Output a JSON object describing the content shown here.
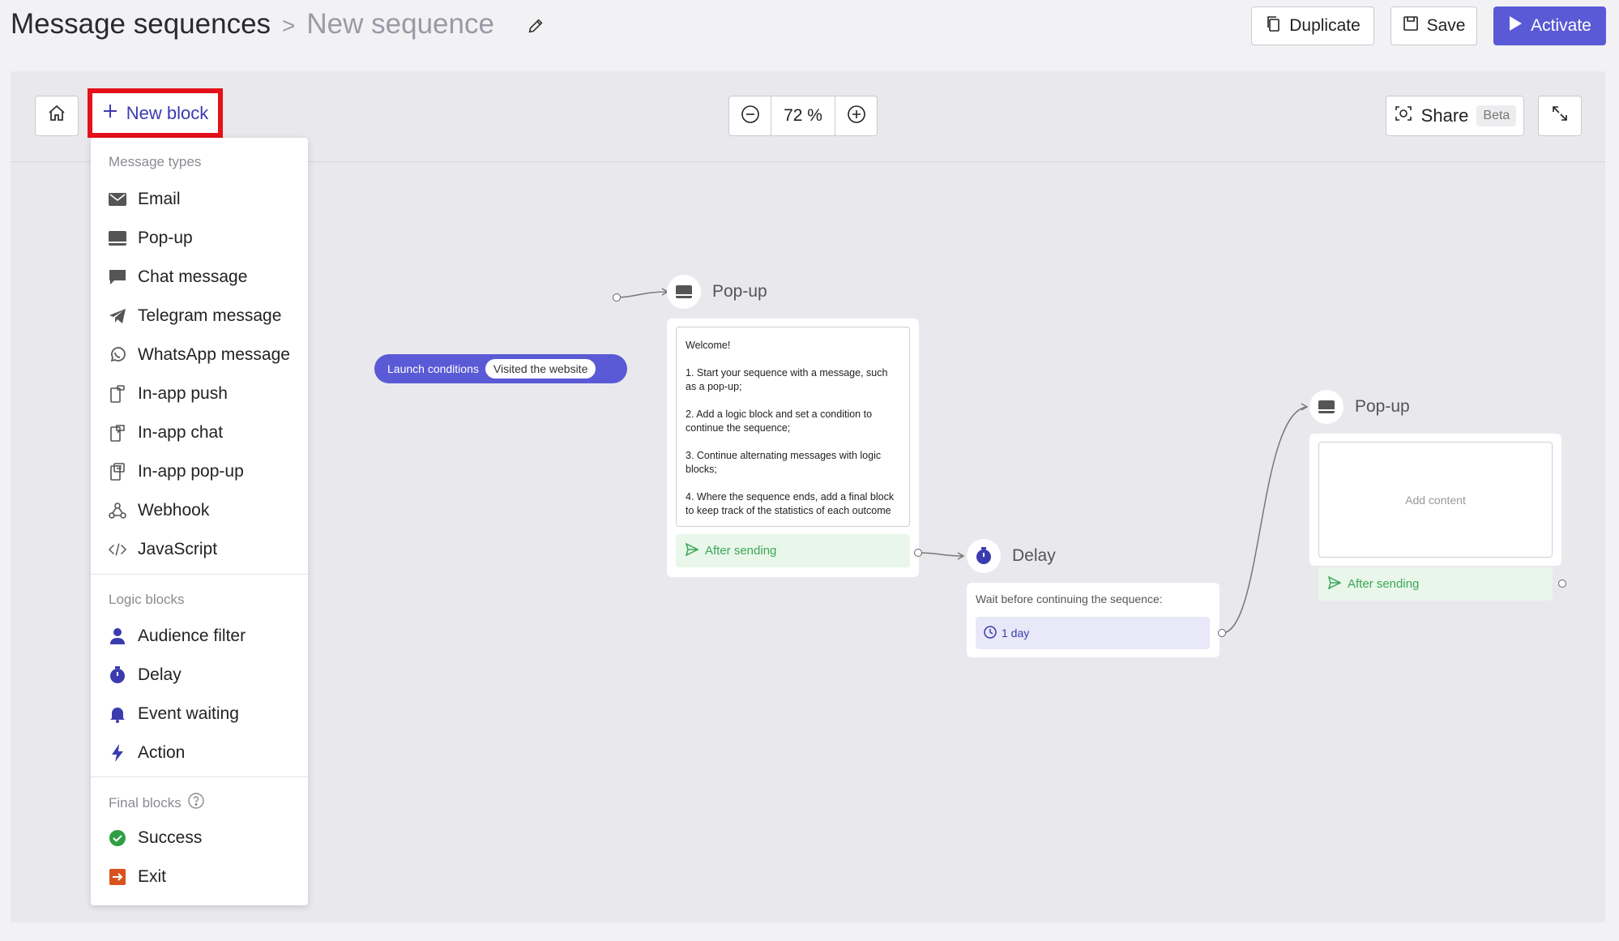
{
  "header": {
    "breadcrumb_root": "Message sequences",
    "breadcrumb_current": "New sequence",
    "duplicate_label": "Duplicate",
    "save_label": "Save",
    "activate_label": "Activate"
  },
  "canvas_toolbar": {
    "new_block_label": "New block",
    "zoom_value": "72 %",
    "share_label": "Share",
    "share_badge": "Beta"
  },
  "menu": {
    "message_types_heading": "Message types",
    "message_types": [
      {
        "label": "Email",
        "icon": "email-icon"
      },
      {
        "label": "Pop-up",
        "icon": "popup-icon"
      },
      {
        "label": "Chat message",
        "icon": "chat-icon"
      },
      {
        "label": "Telegram message",
        "icon": "telegram-icon"
      },
      {
        "label": "WhatsApp message",
        "icon": "whatsapp-icon"
      },
      {
        "label": "In-app push",
        "icon": "in-app-push-icon"
      },
      {
        "label": "In-app chat",
        "icon": "in-app-chat-icon"
      },
      {
        "label": "In-app pop-up",
        "icon": "in-app-popup-icon"
      },
      {
        "label": "Webhook",
        "icon": "webhook-icon"
      },
      {
        "label": "JavaScript",
        "icon": "code-icon"
      }
    ],
    "logic_blocks_heading": "Logic blocks",
    "logic_blocks": [
      {
        "label": "Audience filter",
        "icon": "person-icon"
      },
      {
        "label": "Delay",
        "icon": "timer-icon"
      },
      {
        "label": "Event waiting",
        "icon": "bell-icon"
      },
      {
        "label": "Action",
        "icon": "lightning-icon"
      }
    ],
    "final_blocks_heading": "Final blocks",
    "final_blocks": [
      {
        "label": "Success",
        "icon": "check-circle-icon"
      },
      {
        "label": "Exit",
        "icon": "exit-icon"
      }
    ]
  },
  "flow": {
    "launch_label": "Launch conditions",
    "launch_value": "Visited the website",
    "popup1": {
      "title": "Pop-up",
      "content": [
        "Welcome!",
        "1. Start your sequence with a message, such as a pop-up;",
        "2. Add a logic block and set a condition to continue the sequence;",
        "3. Continue alternating messages with logic blocks;",
        "4. Where the sequence ends, add a final block to keep track of the statistics of each outcome"
      ],
      "after_label": "After sending"
    },
    "delay": {
      "title": "Delay",
      "text": "Wait before continuing the sequence:",
      "value": "1 day"
    },
    "popup2": {
      "title": "Pop-up",
      "placeholder": "Add content",
      "after_label": "After sending"
    }
  },
  "colors": {
    "accent": "#5a5ad6",
    "highlight": "#e5101a",
    "success": "#3aa757"
  }
}
